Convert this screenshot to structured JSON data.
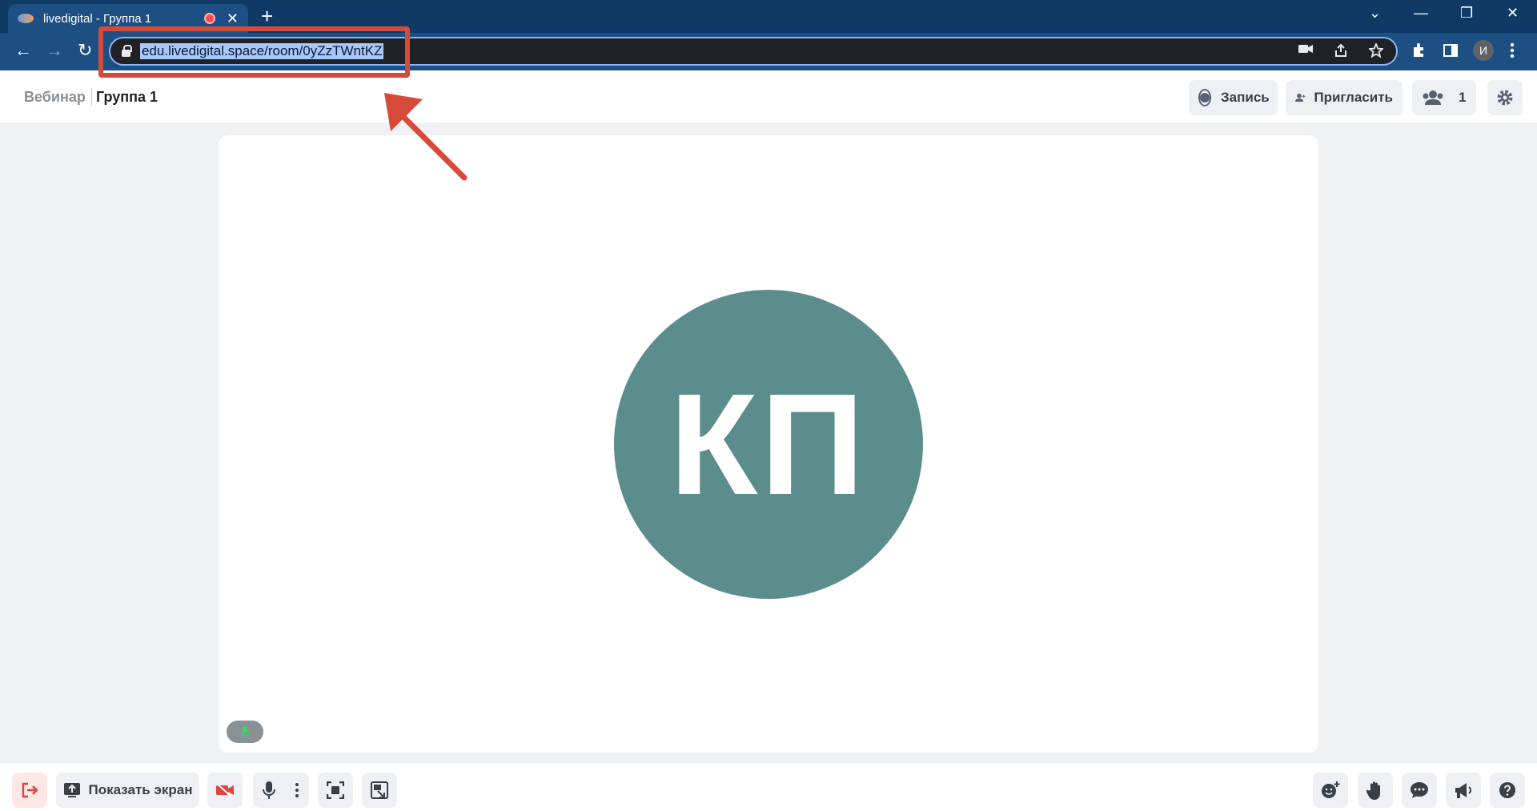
{
  "browser": {
    "tab_title": "livedigital - Группа 1",
    "tab_close": "✕",
    "new_tab": "+",
    "url": "edu.livedigital.space/room/0yZzTWntKZ",
    "profile_initial": "И",
    "window_controls": {
      "menu": "⌄",
      "minimize": "—",
      "restore": "❐",
      "close": "✕"
    },
    "nav": {
      "back": "←",
      "forward": "→",
      "reload": "↻"
    },
    "omnibox_icons": [
      "camera-icon",
      "share-icon",
      "star-icon"
    ],
    "toolbar_icons": [
      "extensions-icon",
      "sidebar-icon"
    ]
  },
  "header": {
    "breadcrumb_section": "Вебинар",
    "breadcrumb_room": "Группа 1",
    "record_label": "Запись",
    "invite_label": "Пригласить",
    "participants_count": "1"
  },
  "stage": {
    "initials": "КП",
    "avatar_color": "#5b8d8c"
  },
  "bottom": {
    "share_screen_label": "Показать экран"
  },
  "colors": {
    "accent_red": "#d64a3a",
    "chrome_dark": "#0f3a66",
    "chrome_toolbar": "#1d4f83"
  }
}
